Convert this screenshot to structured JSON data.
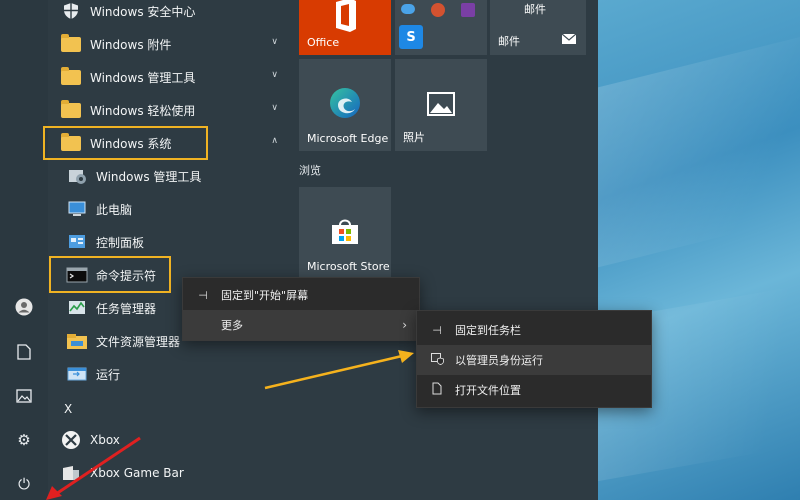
{
  "rail": {
    "user_icon": "user-icon",
    "document_icon": "document-icon",
    "pictures_icon": "pictures-icon",
    "settings_icon": "gear-icon",
    "power_icon": "power-icon"
  },
  "apps": [
    {
      "label": "Windows 安全中心",
      "icon": "shield-icon"
    },
    {
      "label": "Windows 附件",
      "icon": "folder-icon"
    },
    {
      "label": "Windows 管理工具",
      "icon": "folder-icon"
    },
    {
      "label": "Windows 轻松使用",
      "icon": "folder-icon"
    },
    {
      "label": "Windows 系统",
      "icon": "folder-icon"
    },
    {
      "label": "Windows 管理工具",
      "icon": "admin-tools-icon"
    },
    {
      "label": "此电脑",
      "icon": "computer-icon"
    },
    {
      "label": "控制面板",
      "icon": "control-panel-icon"
    },
    {
      "label": "命令提示符",
      "icon": "cmd-icon"
    },
    {
      "label": "任务管理器",
      "icon": "task-manager-icon"
    },
    {
      "label": "文件资源管理器",
      "icon": "explorer-icon"
    },
    {
      "label": "运行",
      "icon": "run-icon"
    },
    {
      "label": "X",
      "icon": ""
    },
    {
      "label": "Xbox",
      "icon": "xbox-icon"
    },
    {
      "label": "Xbox Game Bar",
      "icon": "xbox-game-bar-icon"
    }
  ],
  "tiles": {
    "office": "Office",
    "mail_top": "邮件",
    "mail": "邮件",
    "edge": "Microsoft Edge",
    "photos": "照片",
    "browse_group": "浏览",
    "store": "Microsoft Store"
  },
  "context_menu": {
    "pin_start": "固定到\"开始\"屏幕",
    "more": "更多"
  },
  "submenu": {
    "pin_taskbar": "固定到任务栏",
    "run_as_admin": "以管理员身份运行",
    "open_location": "打开文件位置"
  },
  "colors": {
    "highlight": "#f0b323",
    "office": "#d83b01",
    "arrow": "#f5b21d",
    "red_arrow": "#e02020"
  }
}
